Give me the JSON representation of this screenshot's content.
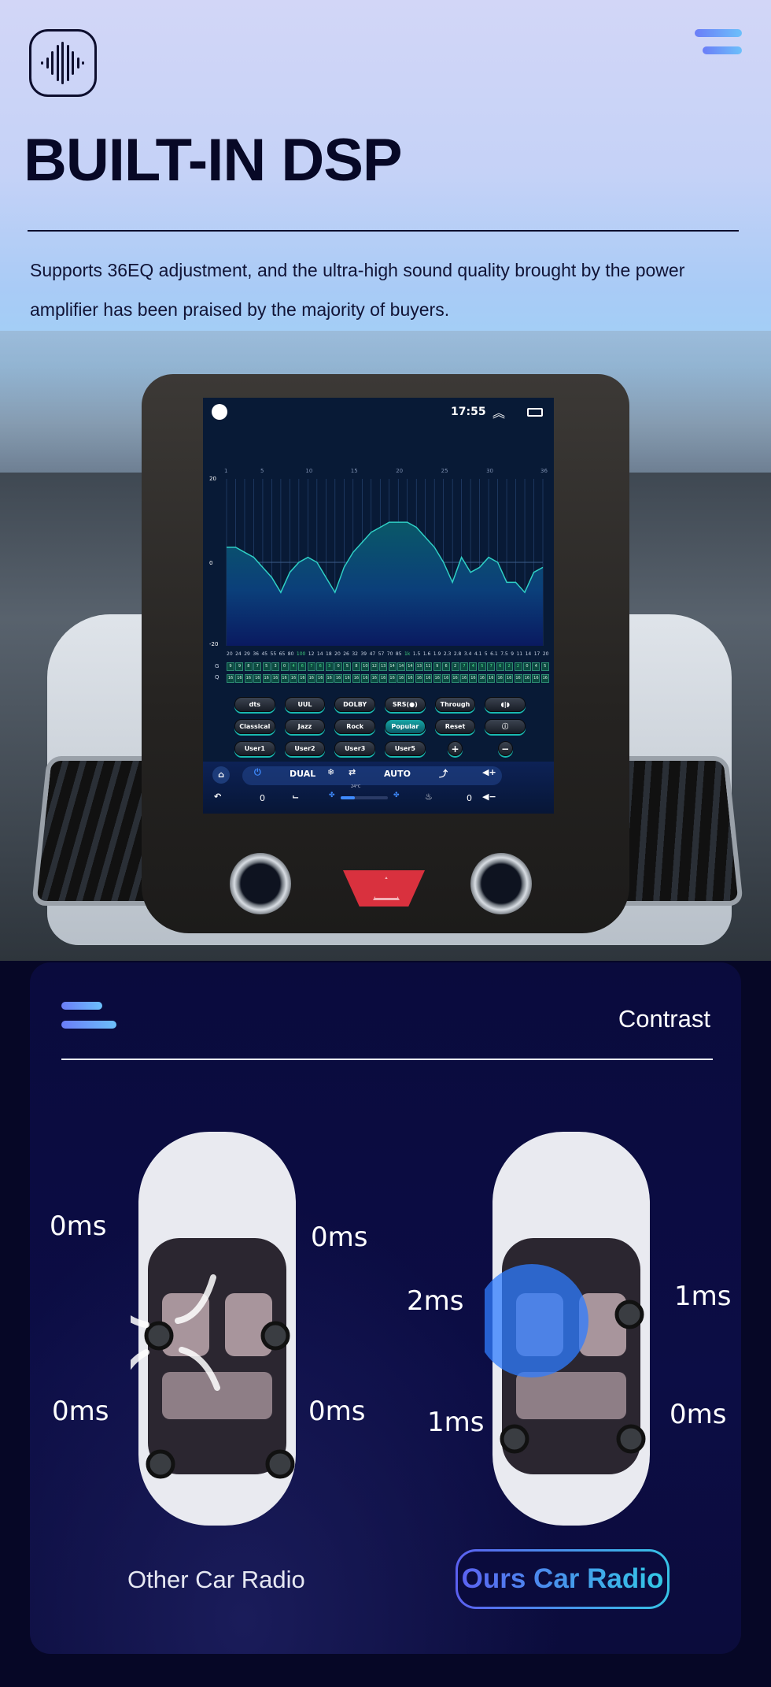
{
  "hero": {
    "title": "BUILT-IN DSP",
    "description": "Supports 36EQ adjustment, and the ultra-high sound quality brought by the power amplifier has been praised by the majority of buyers.",
    "logo_icon": "sound-wave-icon",
    "menu_icon": "menu-icon"
  },
  "head_unit": {
    "status_bar": {
      "time": "17:55",
      "icons": [
        "volume-icon",
        "chevron-up-icon",
        "window-icon"
      ]
    },
    "eq": {
      "band_labels": [
        "1",
        "5",
        "10",
        "15",
        "20",
        "25",
        "30",
        "36"
      ],
      "y_labels": [
        "20",
        "0",
        "-20"
      ],
      "frequencies": [
        "20",
        "24",
        "29",
        "36",
        "45",
        "55",
        "65",
        "80",
        "100",
        "12",
        "14",
        "18",
        "20",
        "26",
        "32",
        "39",
        "47",
        "57",
        "70",
        "85",
        "1k",
        "1.5",
        "1.6",
        "1.9",
        "2.3",
        "2.8",
        "3.4",
        "4.1",
        "5",
        "6.1",
        "7.5",
        "9",
        "11",
        "14",
        "17",
        "20"
      ],
      "highlight_freq_index": [
        8,
        20
      ],
      "g_label": "G",
      "q_label": "Q",
      "gain_values": [
        9,
        9,
        8,
        7,
        5,
        3,
        0,
        4,
        6,
        7,
        6,
        3,
        0,
        5,
        8,
        10,
        12,
        13,
        14,
        14,
        14,
        13,
        11,
        9,
        6,
        2,
        7,
        4,
        5,
        7,
        6,
        2,
        2,
        0,
        4,
        5
      ],
      "gain_highlight": [
        7,
        8,
        9,
        10,
        11,
        26,
        27,
        28,
        29,
        30,
        31,
        32
      ],
      "q_values": [
        16,
        16,
        16,
        16,
        16,
        16,
        16,
        16,
        16,
        16,
        16,
        16,
        16,
        16,
        16,
        16,
        16,
        16,
        16,
        16,
        16,
        16,
        16,
        16,
        16,
        16,
        16,
        16,
        16,
        16,
        16,
        16,
        16,
        16,
        16,
        16
      ]
    },
    "buttons": [
      {
        "label": "dts"
      },
      {
        "label": "UUL"
      },
      {
        "label": "DOLBY"
      },
      {
        "label": "SRS(●)"
      },
      {
        "label": "Through"
      },
      {
        "label": "◖|◗"
      },
      {
        "label": "Classical"
      },
      {
        "label": "Jazz"
      },
      {
        "label": "Rock"
      },
      {
        "label": "Popular",
        "active": true
      },
      {
        "label": "Reset"
      },
      {
        "label": "ⓘ"
      },
      {
        "label": "User1"
      },
      {
        "label": "User2"
      },
      {
        "label": "User3"
      },
      {
        "label": "User5"
      },
      {
        "label": "+"
      },
      {
        "label": "−"
      }
    ],
    "climate": {
      "dual": "DUAL",
      "auto": "AUTO",
      "temp": "24°C",
      "left_value": "0",
      "right_value": "0",
      "fan_level": 0.3,
      "icons": [
        "home-icon",
        "power-icon",
        "snowflake-icon",
        "recirculation-icon",
        "airflow-icon",
        "volume-up-icon",
        "back-icon",
        "seat-icon",
        "fan-icon",
        "seat-heat-icon",
        "volume-down-icon"
      ]
    }
  },
  "contrast": {
    "title": "Contrast",
    "other": {
      "label": "Other Car Radio",
      "delays": {
        "front_left": "0ms",
        "front_right": "0ms",
        "rear_left": "0ms",
        "rear_right": "0ms"
      }
    },
    "ours": {
      "label": "Ours Car Radio",
      "delays": {
        "front_left": "2ms",
        "front_right": "1ms",
        "rear_left": "1ms",
        "rear_right": "0ms"
      }
    }
  },
  "colors": {
    "accent_from": "#5b63f2",
    "accent_to": "#33c9e6",
    "eq_line": "#2fd0c6",
    "dark_bg": "#0a0b3d"
  }
}
